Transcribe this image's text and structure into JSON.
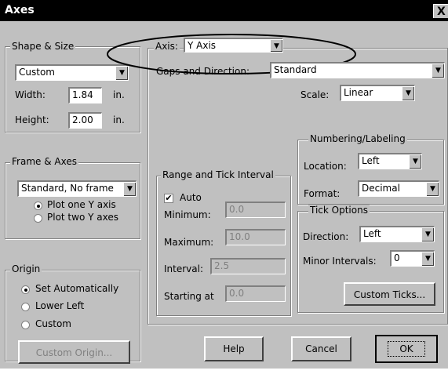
{
  "window": {
    "title": "Axes",
    "close_label": "X"
  },
  "shape_size": {
    "group_label": "Shape & Size",
    "shape_value": "Custom",
    "width_label": "Width:",
    "width_value": "1.84",
    "width_unit": "in.",
    "height_label": "Height:",
    "height_value": "2.00",
    "height_unit": "in."
  },
  "frame_axes": {
    "group_label": "Frame & Axes",
    "frame_value": "Standard, No frame",
    "opt_one": "Plot one Y axis",
    "opt_two": "Plot two Y axes"
  },
  "origin": {
    "group_label": "Origin",
    "opt_auto": "Set Automatically",
    "opt_lower_left": "Lower Left",
    "opt_custom": "Custom",
    "custom_button": "Custom Origin..."
  },
  "axis": {
    "label": "Axis:",
    "value": "Y Axis",
    "gaps_label": "Gaps and Direction:",
    "gaps_value": "Standard",
    "scale_label": "Scale:",
    "scale_value": "Linear"
  },
  "range": {
    "group_label": "Range and Tick Interval",
    "auto_label": "Auto",
    "min_label": "Minimum:",
    "min_value": "0.0",
    "max_label": "Maximum:",
    "max_value": "10.0",
    "interval_label": "Interval:",
    "interval_value": "2.5",
    "start_label": "Starting at",
    "start_value": "0.0"
  },
  "numbering": {
    "group_label": "Numbering/Labeling",
    "location_label": "Location:",
    "location_value": "Left",
    "format_label": "Format:",
    "format_value": "Decimal"
  },
  "tick_options": {
    "group_label": "Tick Options",
    "direction_label": "Direction:",
    "direction_value": "Left",
    "minor_label": "Minor Intervals:",
    "minor_value": "0",
    "custom_ticks_button": "Custom Ticks..."
  },
  "footer": {
    "help": "Help",
    "cancel": "Cancel",
    "ok": "OK"
  }
}
